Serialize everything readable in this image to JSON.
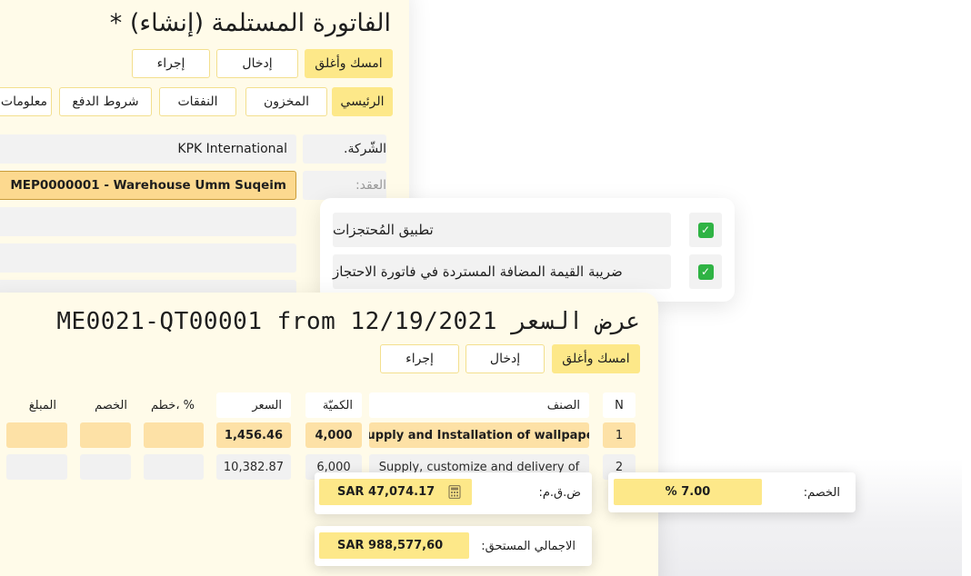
{
  "invoice_window": {
    "title": "الفاتورة المستلمة (إنشاء) *",
    "buttons": {
      "save_close": "امسك وأغلق",
      "entry": "إدخال",
      "action": "إجراء"
    },
    "tabs": [
      "الرئيسي",
      "المخزون",
      "النفقات",
      "شروط الدفع",
      "معلومات"
    ],
    "fields": {
      "company_label": "الشّركة.",
      "company_value": "KPK International",
      "contract_label": "العقد:",
      "contract_value": "MEP0000001 - Warehouse Umm Suqeim"
    }
  },
  "options_card": {
    "options": [
      {
        "label": "تطبيق المُحتجزات",
        "checked": true
      },
      {
        "label": "ضريبة القيمة المضافة المستردة في فاتورة الاحتجاز",
        "checked": true
      }
    ]
  },
  "quotation_window": {
    "title": "ME0021-QT00001 from 12/19/2021 عرض السعر",
    "buttons": {
      "save_close": "امسك وأغلق",
      "entry": "إدخال",
      "action": "إجراء"
    },
    "columns": {
      "n": "N",
      "item": "الصنف",
      "qty": "الكميّة",
      "price": "السعر",
      "disc_pct": "خطم، %",
      "discount": "الخصم",
      "amount": "المبلغ"
    },
    "rows": [
      {
        "n": "1",
        "item": "Supply and Installation of wallpaper",
        "qty": "4,000",
        "price": "1,456.46"
      },
      {
        "n": "2",
        "item": "Supply, customize and delivery of",
        "qty": "6,000",
        "price": "10,382.87"
      }
    ]
  },
  "summary": {
    "vat_label": "ض.ق.م:",
    "vat_value": "SAR 47,074.17",
    "discount_label": "الخصم:",
    "discount_value": "% 7.00",
    "total_label": "الاجمالي المستحق:",
    "total_value": "SAR 988,577,60"
  },
  "colors": {
    "accent_yellow": "#fde889",
    "panel_cream": "#fffbe9",
    "row_highlight": "#fde1a6",
    "check_green": "#2fb344"
  },
  "icons": [
    "calculator-icon",
    "checkbox-checked-icon"
  ]
}
